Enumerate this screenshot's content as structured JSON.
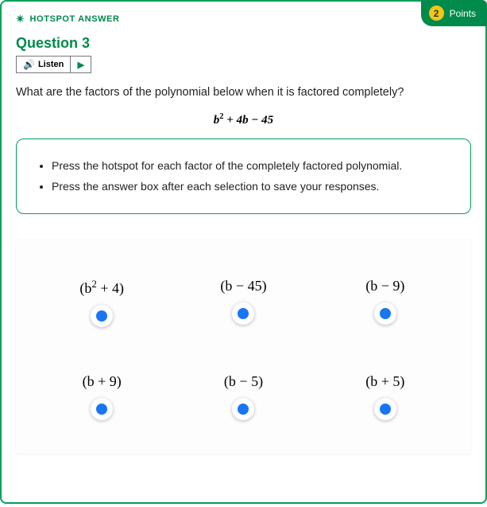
{
  "header": {
    "type_label": "HOTSPOT ANSWER",
    "points_value": "2",
    "points_label": "Points"
  },
  "question": {
    "title": "Question 3",
    "listen_label": "Listen",
    "prompt": "What are the factors of the polynomial below when it is factored completely?",
    "polynomial_html": "b<sup>2</sup> + 4b − 45"
  },
  "instructions": [
    "Press the hotspot for each factor of the completely factored polynomial.",
    "Press the answer box after each selection to save your responses."
  ],
  "options": [
    {
      "label_html": "(b<sup>2</sup> + 4)"
    },
    {
      "label_html": "(b − 45)"
    },
    {
      "label_html": "(b − 9)"
    },
    {
      "label_html": "(b + 9)"
    },
    {
      "label_html": "(b − 5)"
    },
    {
      "label_html": "(b + 5)"
    }
  ]
}
